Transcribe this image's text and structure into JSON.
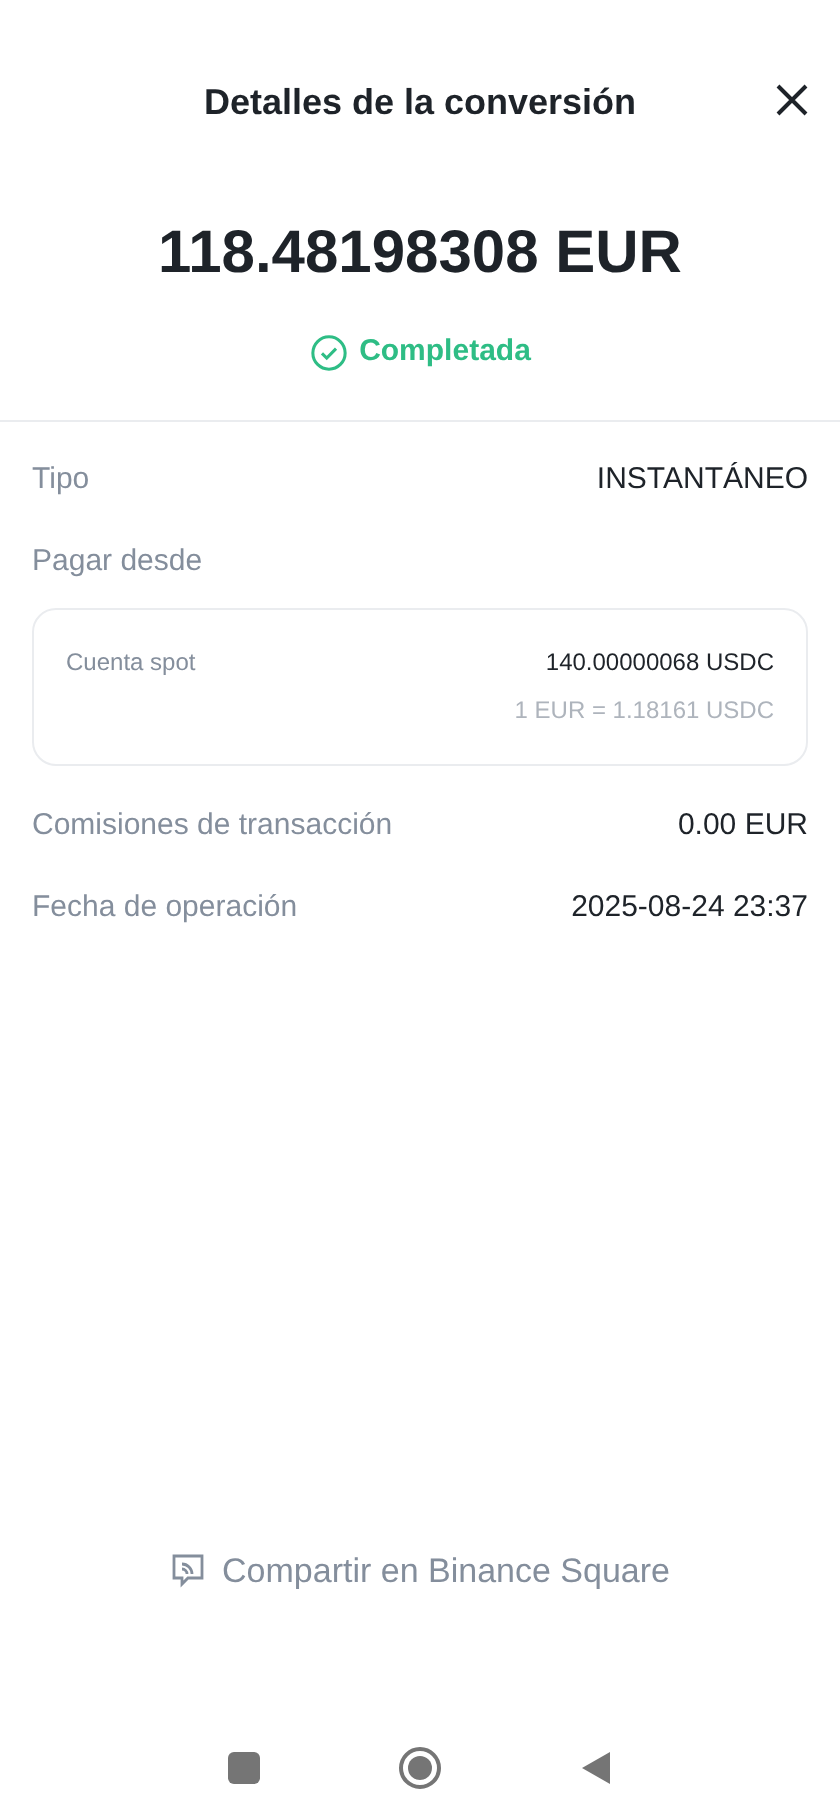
{
  "header": {
    "title": "Detalles de la conversión"
  },
  "amount": "118.48198308 EUR",
  "status": {
    "label": "Completada",
    "kind": "completed"
  },
  "type_row": {
    "label": "Tipo",
    "value": "INSTANTÁNEO"
  },
  "pay_from": {
    "label": "Pagar desde",
    "account": "Cuenta spot",
    "amount": "140.00000068 USDC",
    "rate": "1 EUR = 1.18161 USDC"
  },
  "rows": [
    {
      "label": "Comisiones de transacción",
      "value": "0.00 EUR"
    },
    {
      "label": "Fecha de operación",
      "value": "2025-08-24 23:37"
    }
  ],
  "share": {
    "label": "Compartir en Binance Square"
  }
}
